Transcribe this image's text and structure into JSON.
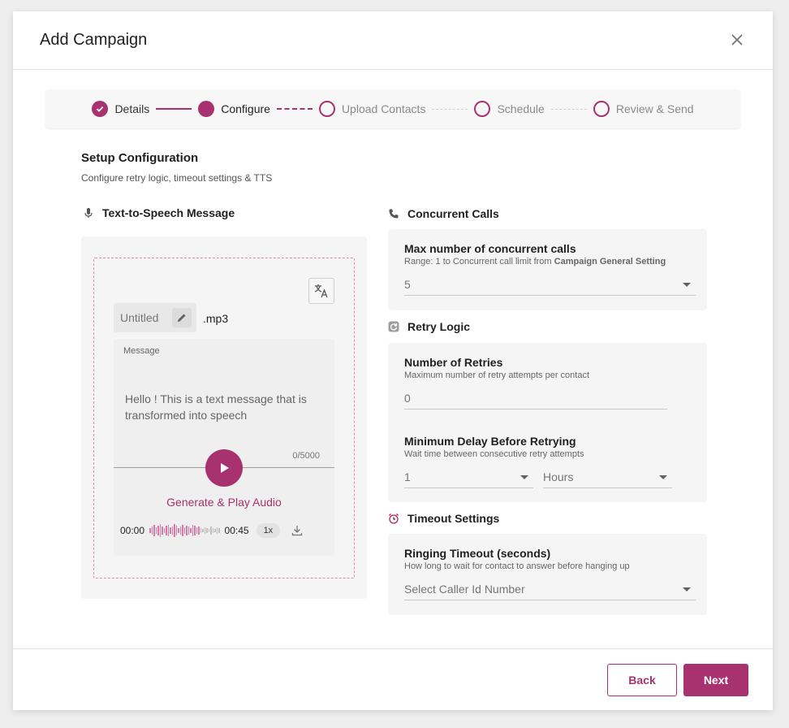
{
  "header": {
    "title": "Add Campaign"
  },
  "stepper": {
    "steps": [
      {
        "label": "Details",
        "state": "done"
      },
      {
        "label": "Configure",
        "state": "active"
      },
      {
        "label": "Upload Contacts",
        "state": "pending"
      },
      {
        "label": "Schedule",
        "state": "pending"
      },
      {
        "label": "Review & Send",
        "state": "pending"
      }
    ]
  },
  "setup": {
    "title": "Setup Configuration",
    "subtitle": "Configure retry logic, timeout settings & TTS"
  },
  "tts": {
    "heading": "Text-to-Speech Message",
    "filename": "Untitled",
    "extension": ".mp3",
    "message_label": "Message",
    "message_text": "Hello ! This is a text message that is transformed into speech",
    "char_count": "0/5000",
    "generate_label": "Generate & Play Audio",
    "time_start": "00:00",
    "time_end": "00:45",
    "speed": "1x"
  },
  "concurrent": {
    "heading": "Concurrent Calls",
    "label": "Max number of concurrent calls",
    "help_prefix": "Range: 1 to Concurrent call limit from ",
    "help_bold": "Campaign General Setting",
    "value": "5"
  },
  "retry": {
    "heading": "Retry Logic",
    "retries_label": "Number of Retries",
    "retries_help": "Maximum number of retry attempts per contact",
    "retries_value": "0",
    "delay_label": "Minimum Delay Before Retrying",
    "delay_help": "Wait time between consecutive retry attempts",
    "delay_value": "1",
    "delay_unit": "Hours"
  },
  "timeout": {
    "heading": "Timeout Settings",
    "label": "Ringing Timeout (seconds)",
    "help": "How long to wait for contact to answer before hanging up",
    "placeholder": "Select Caller Id Number"
  },
  "footer": {
    "back_label": "Back",
    "next_label": "Next"
  },
  "colors": {
    "accent": "#a8316f",
    "dashed_border": "#e38aa7"
  }
}
